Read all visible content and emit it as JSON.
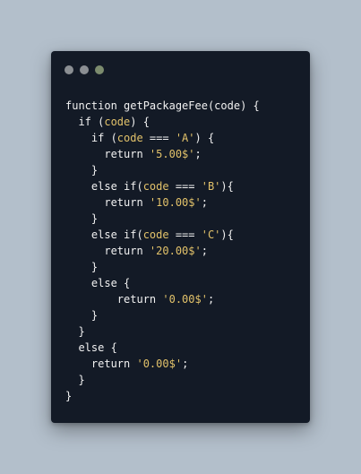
{
  "window": {
    "controls": [
      {
        "name": "close",
        "color": "#8b8f93"
      },
      {
        "name": "minimize",
        "color": "#8b8f93"
      },
      {
        "name": "maximize",
        "color": "#7c8c6e"
      }
    ]
  },
  "code": {
    "lines": [
      [
        {
          "t": "function ",
          "c": "kw"
        },
        {
          "t": "getPackageFee",
          "c": "fn"
        },
        {
          "t": "(code) {",
          "c": "pl"
        }
      ],
      [
        {
          "t": "  if (",
          "c": "kw"
        },
        {
          "t": "code",
          "c": "id"
        },
        {
          "t": ") {",
          "c": "pl"
        }
      ],
      [
        {
          "t": "    if (",
          "c": "kw"
        },
        {
          "t": "code",
          "c": "id"
        },
        {
          "t": " === ",
          "c": "pl"
        },
        {
          "t": "'A'",
          "c": "str"
        },
        {
          "t": ") {",
          "c": "pl"
        }
      ],
      [
        {
          "t": "      return ",
          "c": "kw"
        },
        {
          "t": "'5.00$'",
          "c": "str"
        },
        {
          "t": ";",
          "c": "pl"
        }
      ],
      [
        {
          "t": "    }",
          "c": "pl"
        }
      ],
      [
        {
          "t": "    else if(",
          "c": "kw"
        },
        {
          "t": "code",
          "c": "id"
        },
        {
          "t": " === ",
          "c": "pl"
        },
        {
          "t": "'B'",
          "c": "str"
        },
        {
          "t": "){",
          "c": "pl"
        }
      ],
      [
        {
          "t": "      return ",
          "c": "kw"
        },
        {
          "t": "'10.00$'",
          "c": "str"
        },
        {
          "t": ";",
          "c": "pl"
        }
      ],
      [
        {
          "t": "    }",
          "c": "pl"
        }
      ],
      [
        {
          "t": "    else if(",
          "c": "kw"
        },
        {
          "t": "code",
          "c": "id"
        },
        {
          "t": " === ",
          "c": "pl"
        },
        {
          "t": "'C'",
          "c": "str"
        },
        {
          "t": "){",
          "c": "pl"
        }
      ],
      [
        {
          "t": "      return ",
          "c": "kw"
        },
        {
          "t": "'20.00$'",
          "c": "str"
        },
        {
          "t": ";",
          "c": "pl"
        }
      ],
      [
        {
          "t": "    }",
          "c": "pl"
        }
      ],
      [
        {
          "t": "    else {",
          "c": "kw"
        }
      ],
      [
        {
          "t": "        return ",
          "c": "kw"
        },
        {
          "t": "'0.00$'",
          "c": "str"
        },
        {
          "t": ";",
          "c": "pl"
        }
      ],
      [
        {
          "t": "    }",
          "c": "pl"
        }
      ],
      [
        {
          "t": "  }",
          "c": "pl"
        }
      ],
      [
        {
          "t": "  else {",
          "c": "kw"
        }
      ],
      [
        {
          "t": "    return ",
          "c": "kw"
        },
        {
          "t": "'0.00$'",
          "c": "str"
        },
        {
          "t": ";",
          "c": "pl"
        }
      ],
      [
        {
          "t": "  }",
          "c": "pl"
        }
      ],
      [
        {
          "t": "}",
          "c": "pl"
        }
      ]
    ]
  },
  "colors": {
    "background": "#b3bfcb",
    "window_bg": "#131a26",
    "keyword": "#f1f1f1",
    "highlight": "#e2c26a"
  }
}
